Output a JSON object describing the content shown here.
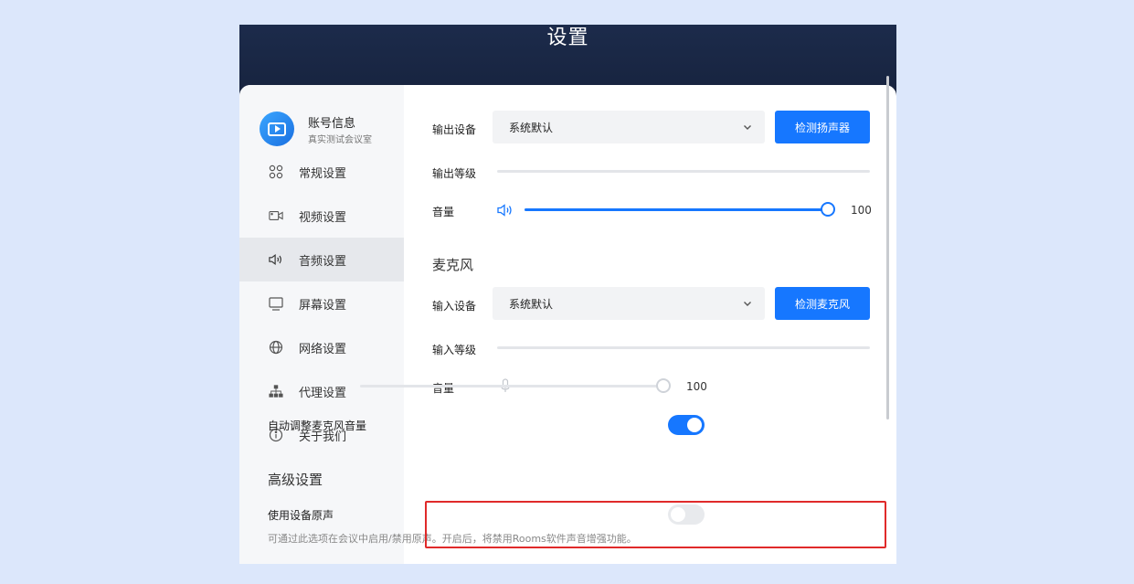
{
  "window": {
    "title": "设置"
  },
  "account": {
    "name": "账号信息",
    "sub": "真实测试会议室"
  },
  "sidebar": {
    "items": [
      {
        "label": "常规设置",
        "icon": "grid-icon"
      },
      {
        "label": "视频设置",
        "icon": "camera-icon"
      },
      {
        "label": "音频设置",
        "icon": "speaker-icon",
        "active": true
      },
      {
        "label": "屏幕设置",
        "icon": "monitor-icon"
      },
      {
        "label": "网络设置",
        "icon": "globe-icon"
      },
      {
        "label": "代理设置",
        "icon": "network-tree-icon"
      },
      {
        "label": "关于我们",
        "icon": "info-icon"
      }
    ]
  },
  "speaker": {
    "output_device_label": "输出设备",
    "output_device_value": "系统默认",
    "test_button": "检测扬声器",
    "output_level_label": "输出等级",
    "output_level": 0,
    "volume_label": "音量",
    "volume_value": "100"
  },
  "microphone": {
    "section_title": "麦克风",
    "input_device_label": "输入设备",
    "input_device_value": "系统默认",
    "test_button": "检测麦克风",
    "input_level_label": "输入等级",
    "input_level": 0,
    "volume_label": "音量",
    "volume_value": "100",
    "auto_adjust_label": "自动调整麦克风音量",
    "auto_adjust_on": true
  },
  "advanced": {
    "section_title": "高级设置",
    "original_sound_label": "使用设备原声",
    "original_sound_on": false,
    "original_sound_desc": "可通过此选项在会议中启用/禁用原声。开启后，将禁用Rooms软件声音增强功能。"
  },
  "colors": {
    "accent": "#1677ff",
    "highlight": "#e02a2a",
    "header": "#16223b"
  }
}
